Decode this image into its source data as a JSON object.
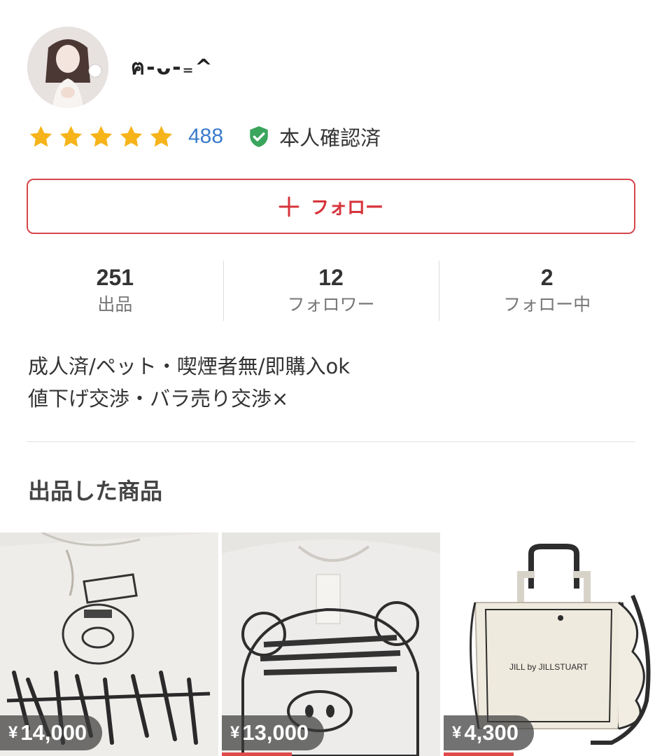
{
  "profile": {
    "username": "ฅ-ᴗ-₌^",
    "rating_count": "488",
    "verified_label": "本人確認済",
    "star_color": "#f6b41a",
    "verified_color": "#3aa55d"
  },
  "follow_button": {
    "label": "フォロー",
    "accent": "#d6353b"
  },
  "stats": [
    {
      "value": "251",
      "label": "出品"
    },
    {
      "value": "12",
      "label": "フォロワー"
    },
    {
      "value": "2",
      "label": "フォロー中"
    }
  ],
  "bio": [
    "成人済/ペット・喫煙者無/即購入ok",
    "値下げ交渉・バラ売り交渉×"
  ],
  "section_title": "出品した商品",
  "items": [
    {
      "currency": "¥",
      "price": "14,000"
    },
    {
      "currency": "¥",
      "price": "13,000"
    },
    {
      "currency": "¥",
      "price": "4,300",
      "tote_text": "JILL by JILLSTUART"
    }
  ]
}
